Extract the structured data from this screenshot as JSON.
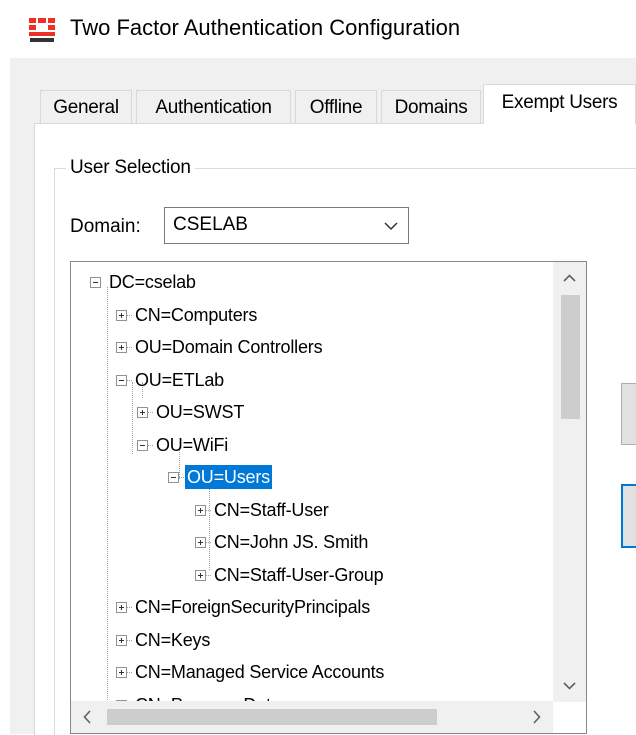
{
  "window": {
    "title": "Two Factor Authentication Configuration",
    "icon_name": "fortinet-logo-icon",
    "brand_color": "#ee3124"
  },
  "tabs": [
    {
      "label": "General",
      "active": false
    },
    {
      "label": "Authentication",
      "active": false
    },
    {
      "label": "Offline",
      "active": false
    },
    {
      "label": "Domains",
      "active": false
    },
    {
      "label": "Exempt Users",
      "active": true
    }
  ],
  "user_selection": {
    "group_label": "User Selection",
    "domain_label": "Domain:",
    "domain_value": "CSELAB"
  },
  "tree": {
    "selected_color": "#0078d7",
    "nodes": [
      {
        "label": "DC=cselab",
        "level": 0,
        "expander": "minus"
      },
      {
        "label": "CN=Computers",
        "level": 1,
        "expander": "plus"
      },
      {
        "label": "OU=Domain Controllers",
        "level": 1,
        "expander": "plus"
      },
      {
        "label": "OU=ETLab",
        "level": 1,
        "expander": "minus"
      },
      {
        "label": "OU=SWST",
        "level": 2,
        "expander": "plus"
      },
      {
        "label": "OU=WiFi",
        "level": 2,
        "expander": "minus"
      },
      {
        "label": "OU=Users",
        "level": 3,
        "expander": "minus",
        "selected": true
      },
      {
        "label": "CN=Staff-User",
        "level": 4,
        "expander": "plus"
      },
      {
        "label": "CN=John JS. Smith",
        "level": 4,
        "expander": "plus"
      },
      {
        "label": "CN=Staff-User-Group",
        "level": 4,
        "expander": "plus"
      },
      {
        "label": "CN=ForeignSecurityPrincipals",
        "level": 1,
        "expander": "plus"
      },
      {
        "label": "CN=Keys",
        "level": 1,
        "expander": "plus"
      },
      {
        "label": "CN=Managed Service Accounts",
        "level": 1,
        "expander": "plus"
      },
      {
        "label": "CN=Program Data",
        "level": 1,
        "expander": "plus"
      }
    ]
  }
}
